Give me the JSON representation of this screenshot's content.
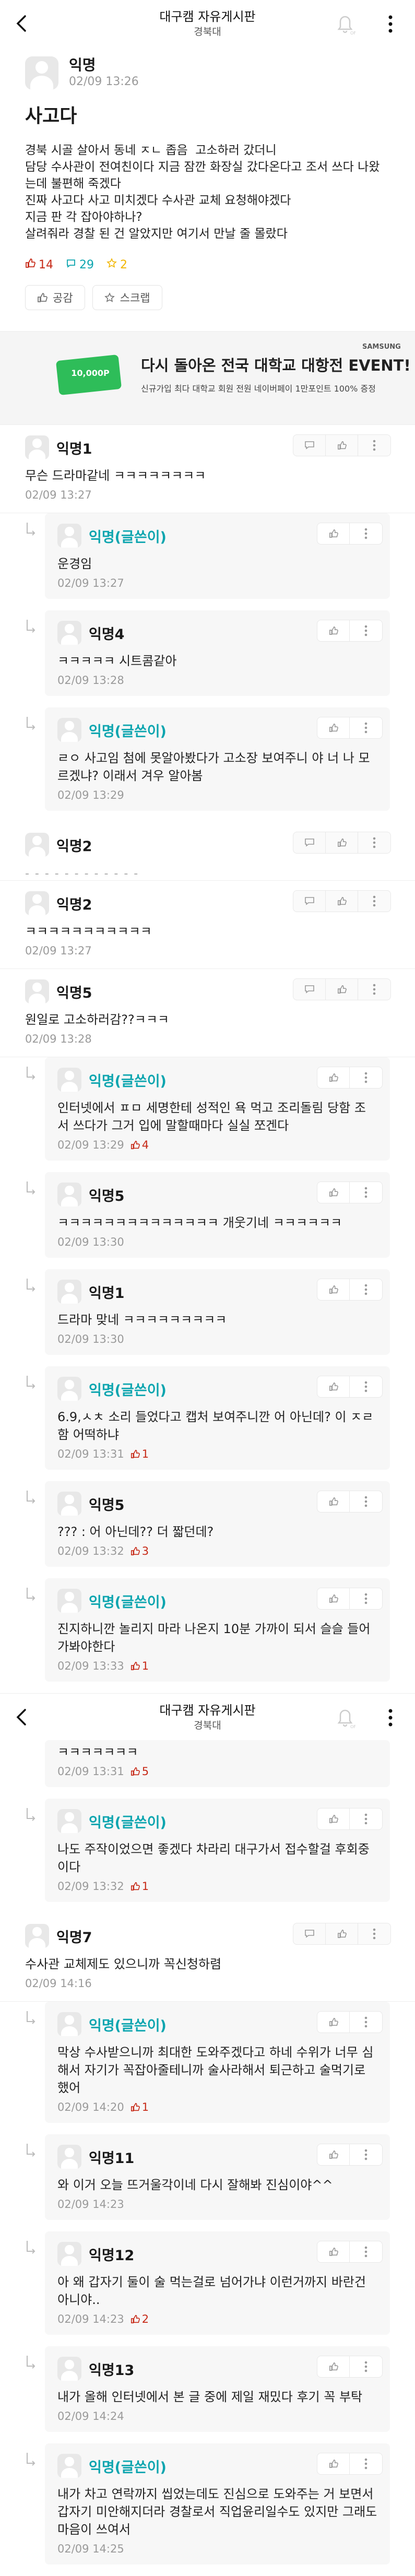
{
  "header": {
    "title": "대구캠 자유게시판",
    "subtitle": "경북대"
  },
  "post": {
    "author": "익명",
    "date": "02/09 13:26",
    "title": "사고다",
    "body": "경북 시골 살아서 동네 ㅈㄴ 좁음  고소하러 갔더니\n담당 수사관이 전여친이다 지금 잠깐 화장실 갔다온다고 조서 쓰다 나왔는데 불편해 죽겠다\n진짜 사고다 사고 미치겠다 수사관 교체 요청해야겠다\n지금 판 각 잡아야하나?\n살려줘라 경찰 된 건 알았지만 여기서 만날 줄 몰랐다",
    "likes": "14",
    "comments": "29",
    "scraps": "2",
    "like_btn": "공감",
    "scrap_btn": "스크랩"
  },
  "ad": {
    "brand": "SAMSUNG",
    "card": "10,000P",
    "headline": "다시 돌아온 전국 대학교 대항전 EVENT!",
    "sub": "신규가입 최다 대학교 회원 전원 네이버페이 1만포인트 100% 증정"
  },
  "comments": [
    {
      "name": "익명1",
      "text": "무슨 드라마같네 ㅋㅋㅋㅋㅋㅋㅋㅋ",
      "date": "02/09 13:27",
      "replies": [
        {
          "name": "익명(글쓴이)",
          "writer": true,
          "text": "운경임",
          "date": "02/09 13:27"
        },
        {
          "name": "익명4",
          "text": "ㅋㅋㅋㅋㅋ 시트콤같아",
          "date": "02/09 13:28"
        },
        {
          "name": "익명(글쓴이)",
          "writer": true,
          "text": "ㄹㅇ 사고임 첨에 못알아봤다가 고소장 보여주니 야 너 나 모르겠냐? 이래서 겨우 알아봄",
          "date": "02/09 13:29"
        }
      ]
    },
    {
      "name": "익명2",
      "deleted": true,
      "text": "- - - - - - - - - - - -"
    },
    {
      "name": "익명2",
      "text": "ㅋㅋㅋㅋㅋㅋㅋㅋㅋㅋㅋ",
      "date": "02/09 13:27"
    },
    {
      "name": "익명5",
      "text": "원일로 고소하러감??ㅋㅋㅋ",
      "date": "02/09 13:28",
      "replies": [
        {
          "name": "익명(글쓴이)",
          "writer": true,
          "text": "인터넷에서 ㅍㅁ 세명한테 성적인 욕 먹고 조리돌림 당함 조서 쓰다가 그거 입에 말할때마다 실실 쪼겐다",
          "date": "02/09 13:29",
          "likes": "4"
        },
        {
          "name": "익명5",
          "text": "ㅋㅋㅋㅋㅋㅋㅋㅋㅋㅋㅋㅋㅋㅋ 개웃기네 ㅋㅋㅋㅋㅋㅋ",
          "date": "02/09 13:30"
        },
        {
          "name": "익명1",
          "text": "드라마 맞네 ㅋㅋㅋㅋㅋㅋㅋㅋㅋ",
          "date": "02/09 13:30"
        },
        {
          "name": "익명(글쓴이)",
          "writer": true,
          "text": "6.9,ㅅㅊ 소리 들었다고 캡처 보여주니깐 어 아닌데? 이 ㅈㄹ함 어떡하냐",
          "date": "02/09 13:31",
          "likes": "1"
        },
        {
          "name": "익명5",
          "text": "??? : 어 아닌데?? 더 짧던데?",
          "date": "02/09 13:32",
          "likes": "3"
        },
        {
          "name": "익명(글쓴이)",
          "writer": true,
          "text": "진지하니깐 놀리지 마라 나온지 10분 가까이 되서 슬슬 들어가봐야한다",
          "date": "02/09 13:33",
          "likes": "1"
        }
      ]
    }
  ],
  "sec2_tail": {
    "text": "ㅋㅋㅋㅋㅋㅋㅋ",
    "date": "02/09 13:31",
    "likes": "5"
  },
  "comments2": [
    {
      "name": "익명(글쓴이)",
      "writer": true,
      "reply": true,
      "text": "나도 주작이었으면 좋겠다 차라리 대구가서 접수할걸 후회중이다",
      "date": "02/09 13:32",
      "likes": "1"
    },
    {
      "name": "익명7",
      "text": "수사관 교체제도 있으니까 꼭신청하렴",
      "date": "02/09 14:16",
      "replies": [
        {
          "name": "익명(글쓴이)",
          "writer": true,
          "text": "막상 수사받으니까 최대한 도와주겠다고 하네 수위가 너무 심해서 자기가 꼭잡아줄테니까 술사라해서 퇴근하고 술먹기로 했어",
          "date": "02/09 14:20",
          "likes": "1"
        },
        {
          "name": "익명11",
          "text": "와 이거 오늘 뜨거울각이네 다시 잘해봐 진심이야^^",
          "date": "02/09 14:23"
        },
        {
          "name": "익명12",
          "text": "아 왜 갑자기 둘이 술 먹는걸로 넘어가냐 이런거까지 바란건 아니야..",
          "date": "02/09 14:23",
          "likes": "2"
        },
        {
          "name": "익명13",
          "text": "내가 올해 인터넷에서 본 글 중에 제일 재밌다 후기 꼭 부탁",
          "date": "02/09 14:24"
        },
        {
          "name": "익명(글쓴이)",
          "writer": true,
          "text": "내가 차고 연락까지 씹었는데도 진심으로 도와주는 거 보면서 갑자기 미안해지더라 경찰로서 직업윤리일수도 있지만 그래도 마음이 쓰여서",
          "date": "02/09 14:25"
        }
      ]
    }
  ]
}
